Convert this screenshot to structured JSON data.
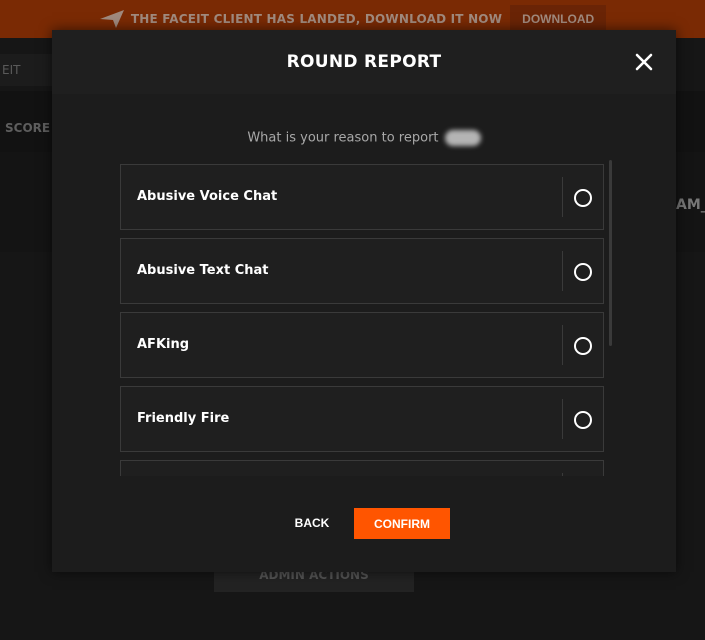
{
  "banner": {
    "text": "THE FACEIT CLIENT HAS LANDED, DOWNLOAD IT NOW",
    "button_label": "DOWNLOAD",
    "icon": "faceit-logo-icon"
  },
  "background": {
    "search_partial": "EIT",
    "scoreboard_partial": "SCORE",
    "team_partial": "AM_",
    "admin_actions_label": "ADMIN ACTIONS"
  },
  "modal": {
    "title": "ROUND REPORT",
    "close_icon": "close-icon",
    "prompt": "What is your reason to report",
    "options": [
      {
        "label": "Abusive Voice Chat",
        "selected": false
      },
      {
        "label": "Abusive Text Chat",
        "selected": false
      },
      {
        "label": "AFKing",
        "selected": false
      },
      {
        "label": "Friendly Fire",
        "selected": false
      },
      {
        "label": "",
        "selected": false
      }
    ],
    "back_label": "BACK",
    "confirm_label": "CONFIRM"
  },
  "colors": {
    "accent": "#ff5500",
    "banner_bg": "#7a2a04",
    "modal_bg": "#1c1c1c"
  }
}
